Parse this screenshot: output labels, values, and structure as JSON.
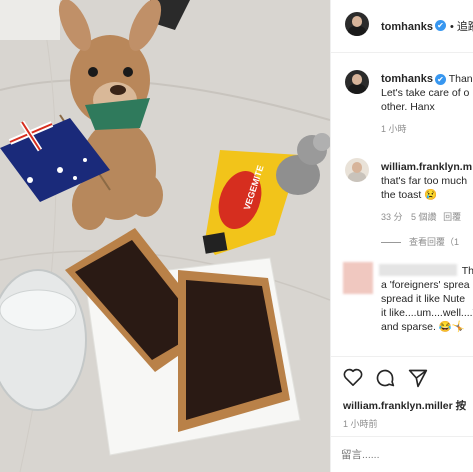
{
  "header": {
    "username": "tomhanks",
    "verified_mark": "✔",
    "follow_label": "• 追蹤"
  },
  "post": {
    "username": "tomhanks",
    "caption_lines": [
      "Than",
      "Let's take care of o",
      "other. Hanx"
    ],
    "time": "1 小時"
  },
  "comment1": {
    "username": "william.franklyn.m",
    "text_lines": [
      "that's far too much",
      "the toast 😢"
    ],
    "time": "33 分",
    "likes": "5 個讚",
    "reply_label": "回覆",
    "view_replies": "查看回覆（1"
  },
  "comment2": {
    "text_lines": [
      "Th",
      "a 'foreigners' sprea",
      "spread it like Nute",
      "it like....um....well....V",
      "and sparse. 😂🤸"
    ]
  },
  "actions": {
    "like_icon": "heart-icon",
    "comment_icon": "comment-icon",
    "share_icon": "share-icon"
  },
  "liked_by": "william.franklyn.miller 按",
  "post_time": "1 小時前",
  "comment_box": {
    "placeholder": "留言......"
  },
  "photo": {
    "jar_label": "VEGEMITE",
    "colors": {
      "flag_blue": "#1a2a7a",
      "vegemite_yellow": "#f2c41a",
      "vegemite_red": "#d62e1f",
      "spread": "#2a1a14"
    }
  }
}
